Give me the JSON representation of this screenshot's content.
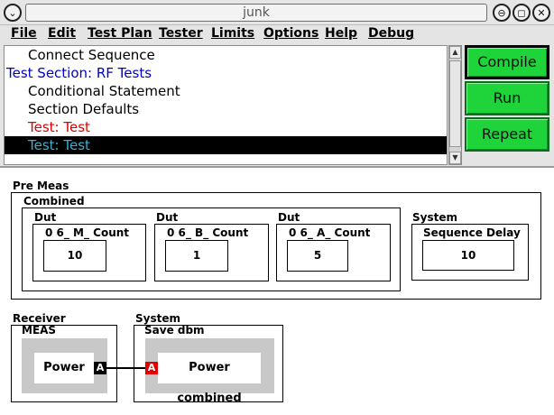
{
  "window": {
    "title": "junk",
    "menu_icon": "chevron-down-icon",
    "controls": [
      {
        "name": "minimize-icon",
        "glyph": "⊖"
      },
      {
        "name": "maximize-icon",
        "glyph": "◻"
      },
      {
        "name": "close-icon",
        "glyph": "✕"
      }
    ]
  },
  "menu": [
    "File",
    "Edit",
    "Test Plan",
    "Tester",
    "Limits",
    "Options",
    "Help",
    "Debug"
  ],
  "sequence": [
    {
      "label": "Connect Sequence",
      "color": "#000000",
      "indent": true,
      "selected": false
    },
    {
      "label": "Test Section: RF Tests",
      "color": "#0000c8",
      "indent": false,
      "selected": false
    },
    {
      "label": "Conditional Statement",
      "color": "#000000",
      "indent": true,
      "selected": false
    },
    {
      "label": "Section Defaults",
      "color": "#000000",
      "indent": true,
      "selected": false
    },
    {
      "label": "Test: Test",
      "color": "#e00000",
      "indent": true,
      "selected": false
    },
    {
      "label": "Test: Test",
      "color": "#3ab0d0",
      "indent": true,
      "selected": true
    }
  ],
  "buttons": {
    "compile": "Compile",
    "run": "Run",
    "repeat": "Repeat"
  },
  "colors": {
    "button_green": "#1fd33a",
    "selected_row": "#000000",
    "port_in": "#e00000",
    "port_out": "#000000"
  },
  "pre_meas": {
    "label": "Pre Meas",
    "combined": {
      "label": "Combined",
      "duts": [
        {
          "group": "Dut",
          "name": "0 6_ M_ Count",
          "value": "10"
        },
        {
          "group": "Dut",
          "name": "0 6_ B_ Count",
          "value": "1"
        },
        {
          "group": "Dut",
          "name": "0 6_ A_ Count",
          "value": "5"
        }
      ]
    },
    "system": {
      "group": "System",
      "name": "Sequence Delay",
      "value": "10"
    }
  },
  "receiver": {
    "group": "Receiver",
    "name": "MEAS",
    "block": "Power",
    "port": "A"
  },
  "system2": {
    "group": "System",
    "name": "Save dbm",
    "block": "Power combined",
    "port": "A"
  }
}
